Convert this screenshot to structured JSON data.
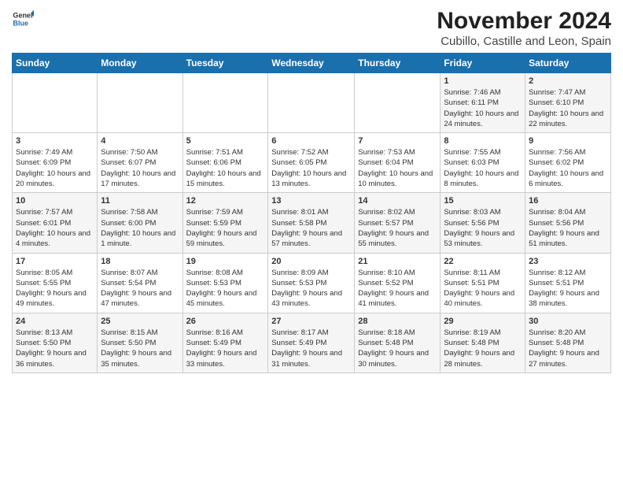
{
  "logo": {
    "general": "General",
    "blue": "Blue"
  },
  "header": {
    "month": "November 2024",
    "location": "Cubillo, Castille and Leon, Spain"
  },
  "weekdays": [
    "Sunday",
    "Monday",
    "Tuesday",
    "Wednesday",
    "Thursday",
    "Friday",
    "Saturday"
  ],
  "weeks": [
    [
      {
        "day": "",
        "info": ""
      },
      {
        "day": "",
        "info": ""
      },
      {
        "day": "",
        "info": ""
      },
      {
        "day": "",
        "info": ""
      },
      {
        "day": "",
        "info": ""
      },
      {
        "day": "1",
        "info": "Sunrise: 7:46 AM\nSunset: 6:11 PM\nDaylight: 10 hours and 24 minutes."
      },
      {
        "day": "2",
        "info": "Sunrise: 7:47 AM\nSunset: 6:10 PM\nDaylight: 10 hours and 22 minutes."
      }
    ],
    [
      {
        "day": "3",
        "info": "Sunrise: 7:49 AM\nSunset: 6:09 PM\nDaylight: 10 hours and 20 minutes."
      },
      {
        "day": "4",
        "info": "Sunrise: 7:50 AM\nSunset: 6:07 PM\nDaylight: 10 hours and 17 minutes."
      },
      {
        "day": "5",
        "info": "Sunrise: 7:51 AM\nSunset: 6:06 PM\nDaylight: 10 hours and 15 minutes."
      },
      {
        "day": "6",
        "info": "Sunrise: 7:52 AM\nSunset: 6:05 PM\nDaylight: 10 hours and 13 minutes."
      },
      {
        "day": "7",
        "info": "Sunrise: 7:53 AM\nSunset: 6:04 PM\nDaylight: 10 hours and 10 minutes."
      },
      {
        "day": "8",
        "info": "Sunrise: 7:55 AM\nSunset: 6:03 PM\nDaylight: 10 hours and 8 minutes."
      },
      {
        "day": "9",
        "info": "Sunrise: 7:56 AM\nSunset: 6:02 PM\nDaylight: 10 hours and 6 minutes."
      }
    ],
    [
      {
        "day": "10",
        "info": "Sunrise: 7:57 AM\nSunset: 6:01 PM\nDaylight: 10 hours and 4 minutes."
      },
      {
        "day": "11",
        "info": "Sunrise: 7:58 AM\nSunset: 6:00 PM\nDaylight: 10 hours and 1 minute."
      },
      {
        "day": "12",
        "info": "Sunrise: 7:59 AM\nSunset: 5:59 PM\nDaylight: 9 hours and 59 minutes."
      },
      {
        "day": "13",
        "info": "Sunrise: 8:01 AM\nSunset: 5:58 PM\nDaylight: 9 hours and 57 minutes."
      },
      {
        "day": "14",
        "info": "Sunrise: 8:02 AM\nSunset: 5:57 PM\nDaylight: 9 hours and 55 minutes."
      },
      {
        "day": "15",
        "info": "Sunrise: 8:03 AM\nSunset: 5:56 PM\nDaylight: 9 hours and 53 minutes."
      },
      {
        "day": "16",
        "info": "Sunrise: 8:04 AM\nSunset: 5:56 PM\nDaylight: 9 hours and 51 minutes."
      }
    ],
    [
      {
        "day": "17",
        "info": "Sunrise: 8:05 AM\nSunset: 5:55 PM\nDaylight: 9 hours and 49 minutes."
      },
      {
        "day": "18",
        "info": "Sunrise: 8:07 AM\nSunset: 5:54 PM\nDaylight: 9 hours and 47 minutes."
      },
      {
        "day": "19",
        "info": "Sunrise: 8:08 AM\nSunset: 5:53 PM\nDaylight: 9 hours and 45 minutes."
      },
      {
        "day": "20",
        "info": "Sunrise: 8:09 AM\nSunset: 5:53 PM\nDaylight: 9 hours and 43 minutes."
      },
      {
        "day": "21",
        "info": "Sunrise: 8:10 AM\nSunset: 5:52 PM\nDaylight: 9 hours and 41 minutes."
      },
      {
        "day": "22",
        "info": "Sunrise: 8:11 AM\nSunset: 5:51 PM\nDaylight: 9 hours and 40 minutes."
      },
      {
        "day": "23",
        "info": "Sunrise: 8:12 AM\nSunset: 5:51 PM\nDaylight: 9 hours and 38 minutes."
      }
    ],
    [
      {
        "day": "24",
        "info": "Sunrise: 8:13 AM\nSunset: 5:50 PM\nDaylight: 9 hours and 36 minutes."
      },
      {
        "day": "25",
        "info": "Sunrise: 8:15 AM\nSunset: 5:50 PM\nDaylight: 9 hours and 35 minutes."
      },
      {
        "day": "26",
        "info": "Sunrise: 8:16 AM\nSunset: 5:49 PM\nDaylight: 9 hours and 33 minutes."
      },
      {
        "day": "27",
        "info": "Sunrise: 8:17 AM\nSunset: 5:49 PM\nDaylight: 9 hours and 31 minutes."
      },
      {
        "day": "28",
        "info": "Sunrise: 8:18 AM\nSunset: 5:48 PM\nDaylight: 9 hours and 30 minutes."
      },
      {
        "day": "29",
        "info": "Sunrise: 8:19 AM\nSunset: 5:48 PM\nDaylight: 9 hours and 28 minutes."
      },
      {
        "day": "30",
        "info": "Sunrise: 8:20 AM\nSunset: 5:48 PM\nDaylight: 9 hours and 27 minutes."
      }
    ]
  ]
}
